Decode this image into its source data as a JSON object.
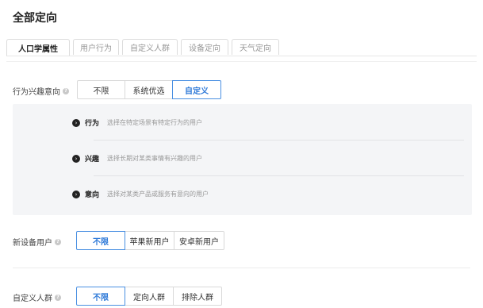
{
  "page_title": "全部定向",
  "tabs": [
    {
      "label": "人口学属性",
      "active": true
    },
    {
      "label": "用户行为",
      "active": false
    },
    {
      "label": "自定义人群",
      "active": false
    },
    {
      "label": "设备定向",
      "active": false
    },
    {
      "label": "天气定向",
      "active": false
    }
  ],
  "intent_row": {
    "label": "行为兴趣意向",
    "help_icon": "question-circle-icon",
    "options": [
      "不限",
      "系统优选",
      "自定义"
    ],
    "selected": "自定义"
  },
  "intent_panel": {
    "items": [
      {
        "icon": "chevron-right-circle-icon",
        "title": "行为",
        "desc": "选择在特定场景有特定行为的用户"
      },
      {
        "icon": "chevron-right-circle-icon",
        "title": "兴趣",
        "desc": "选择长期对某类事情有兴趣的用户"
      },
      {
        "icon": "chevron-right-circle-icon",
        "title": "意向",
        "desc": "选择对某类产品或服务有意向的用户"
      }
    ]
  },
  "new_device_row": {
    "label": "新设备用户",
    "help_icon": "question-circle-icon",
    "options": [
      "不限",
      "苹果新用户",
      "安卓新用户"
    ],
    "selected": "不限"
  },
  "custom_audience_row": {
    "label": "自定义人群",
    "help_icon": "question-circle-icon",
    "options": [
      "不限",
      "定向人群",
      "排除人群"
    ],
    "selected": "不限"
  },
  "colors": {
    "accent": "#2f7ad8",
    "panel_bg": "#f4f5f7"
  }
}
